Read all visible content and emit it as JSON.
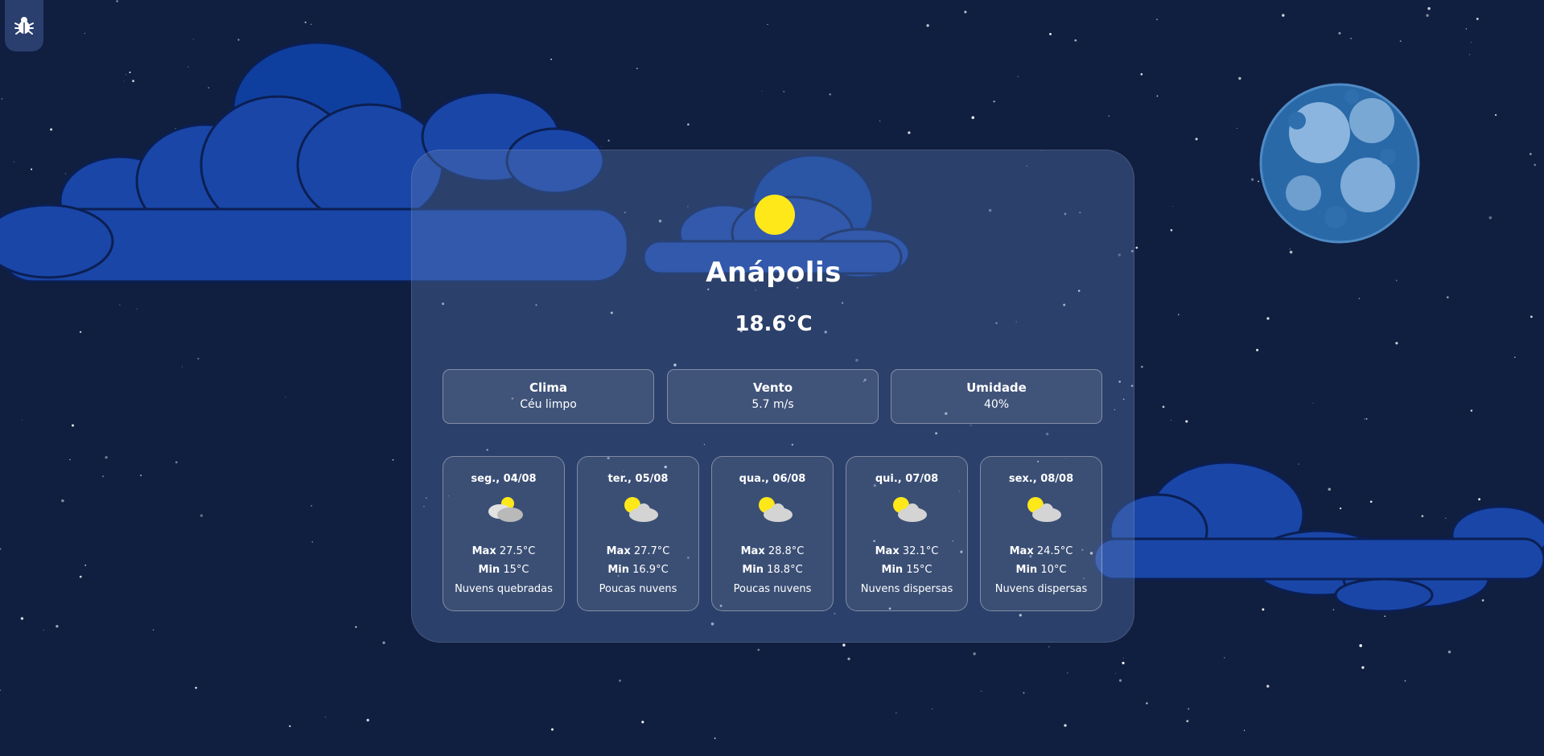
{
  "colors": {
    "background": "#101e40",
    "cloud": "#1e4bb0",
    "sun": "#ffe81a",
    "moon": "#8fb6e0"
  },
  "debug_button": {
    "icon": "bug-icon"
  },
  "weather": {
    "icon": "sun-icon",
    "city": "Anápolis",
    "temperature": "18.6°C",
    "details": [
      {
        "label": "Clima",
        "value": "Céu limpo"
      },
      {
        "label": "Vento",
        "value": "5.7 m/s"
      },
      {
        "label": "Umidade",
        "value": "40%"
      }
    ]
  },
  "forecast": {
    "max_label": "Max",
    "min_label": "Min",
    "days": [
      {
        "date": "seg., 04/08",
        "icon": "broken-clouds-icon",
        "max": "27.5°C",
        "min": "15°C",
        "description": "Nuvens quebradas"
      },
      {
        "date": "ter., 05/08",
        "icon": "partly-cloudy-icon",
        "max": "27.7°C",
        "min": "16.9°C",
        "description": "Poucas nuvens"
      },
      {
        "date": "qua., 06/08",
        "icon": "partly-cloudy-icon",
        "max": "28.8°C",
        "min": "18.8°C",
        "description": "Poucas nuvens"
      },
      {
        "date": "qui., 07/08",
        "icon": "partly-cloudy-icon",
        "max": "32.1°C",
        "min": "15°C",
        "description": "Nuvens dispersas"
      },
      {
        "date": "sex., 08/08",
        "icon": "partly-cloudy-icon",
        "max": "24.5°C",
        "min": "10°C",
        "description": "Nuvens dispersas"
      }
    ]
  }
}
